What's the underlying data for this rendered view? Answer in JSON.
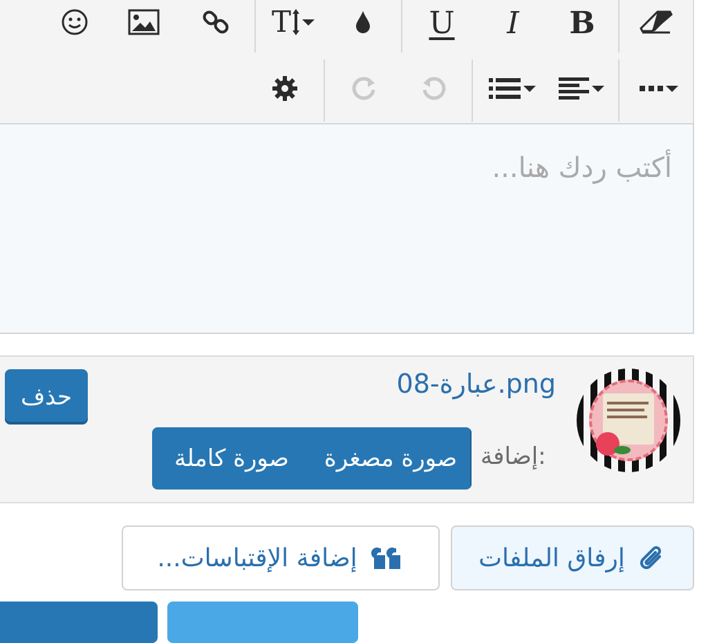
{
  "editor": {
    "placeholder": "أكتب ردك هنا..."
  },
  "attachment": {
    "filename": "عبارة-08.png",
    "insert_label": "إضافة:",
    "thumbnail_button": "صورة مصغرة",
    "fullimage_button": "صورة كاملة",
    "delete_button": "حذف"
  },
  "actions": {
    "attach_files": "إرفاق الملفات",
    "add_quotes": "إضافة الإقتباسات..."
  },
  "toolbar": {
    "bold": "B",
    "italic": "I",
    "underline": "U"
  },
  "colors": {
    "primary": "#2777b4",
    "link": "#2a6fad"
  }
}
